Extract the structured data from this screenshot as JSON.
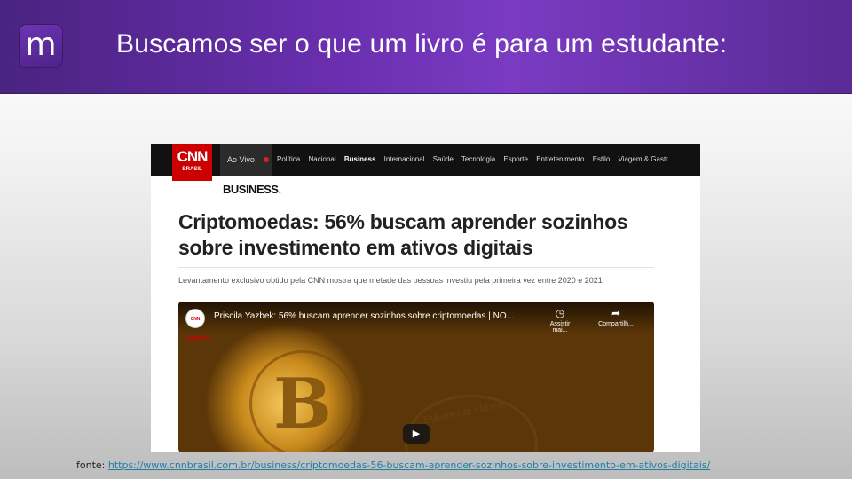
{
  "slide": {
    "logo_letter": "m",
    "title": "Buscamos ser o que um livro é para um estudante:"
  },
  "article": {
    "brand_big": "CNN",
    "brand_small": "BRASIL",
    "live_label": "Ao Vivo",
    "nav": [
      "Política",
      "Nacional",
      "Business",
      "Internacional",
      "Saúde",
      "Tecnologia",
      "Esporte",
      "Entretenimento",
      "Estilo",
      "Viagem & Gastr"
    ],
    "active_nav": "Business",
    "section": "BUSINESS",
    "section_dot": ".",
    "headline": "Criptomoedas: 56% buscam aprender sozinhos sobre investimento em ativos digitais",
    "lede": "Levantamento exclusivo obtido pela CNN mostra que metade das pessoas investiu pela primeira vez entre 2020 e 2021",
    "video": {
      "channel": "CNN BUSINESS",
      "title": "Priscila Yazbek: 56% buscam aprender sozinhos sobre criptomoedas | NO...",
      "watch_later_label": "Assistir mai...",
      "share_label": "Compartilh...",
      "coin_symbol": "B",
      "coin_text": "Ethereum classic"
    }
  },
  "footer": {
    "source_label": "fonte:",
    "source_url": "https://www.cnnbrasil.com.br/business/criptomoedas-56-buscam-aprender-sozinhos-sobre-investimento-em-ativos-digitais/"
  },
  "colors": {
    "header_purple": "#6a2fb0",
    "cnn_red": "#cc0000",
    "link": "#1f7fa6"
  }
}
